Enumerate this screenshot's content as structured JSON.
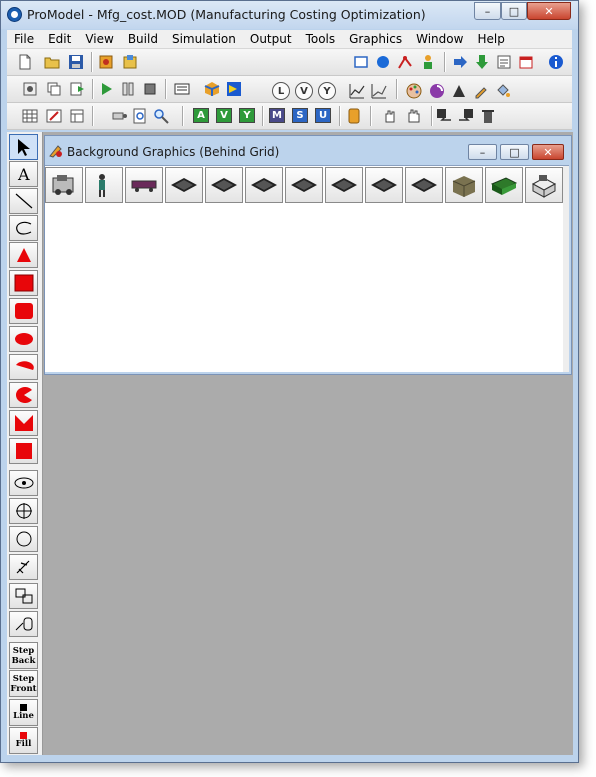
{
  "window": {
    "title": "ProModel - Mfg_cost.MOD (Manufacturing Costing Optimization)",
    "controls": [
      "–",
      "□",
      "✕"
    ]
  },
  "menu": [
    "File",
    "Edit",
    "View",
    "Build",
    "Simulation",
    "Output",
    "Tools",
    "Graphics",
    "Window",
    "Help"
  ],
  "toolbar": {
    "build_letters": [
      "A",
      "V",
      "Y"
    ],
    "build_letter_colors": [
      "#2e9a3a",
      "#2e9a3a",
      "#2e9a3a"
    ],
    "output_letters": [
      "M",
      "S",
      "U"
    ],
    "output_letter_colors": [
      "#4a4a8a",
      "#2c66c4",
      "#2c66c4"
    ],
    "circle_letters": [
      "L",
      "V",
      "Y"
    ]
  },
  "palette": {
    "step_back": "Step Back",
    "step_front": "Step Front",
    "line": "Line",
    "fill": "Fill"
  },
  "child_window": {
    "title": "Background Graphics (Behind Grid)",
    "controls": [
      "–",
      "□",
      "✕"
    ]
  },
  "colors": {
    "accent_red": "#e8060a",
    "workspace_gray": "#ababab",
    "frame_blue": "#bcd3ec"
  }
}
